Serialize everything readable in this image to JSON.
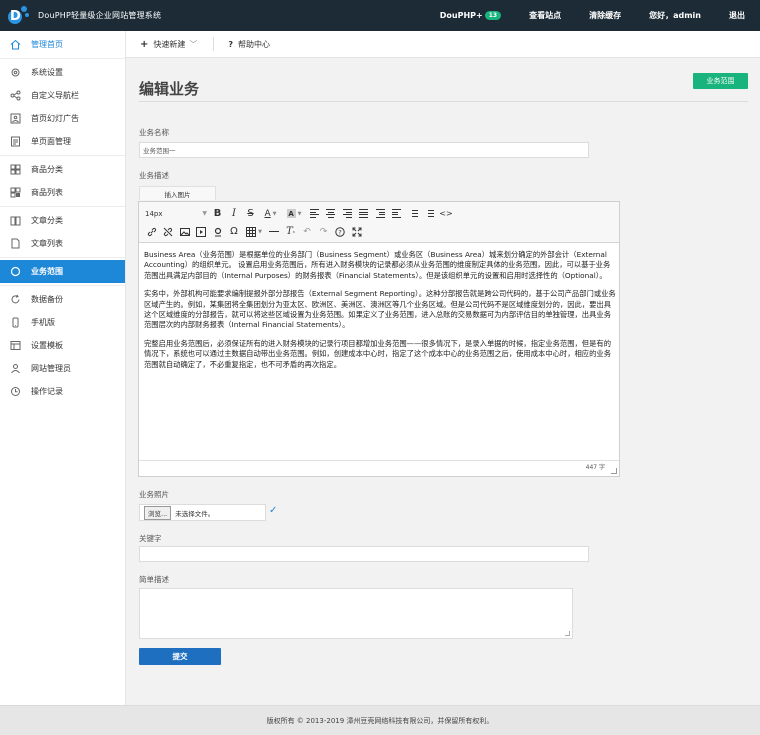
{
  "header": {
    "site_title": "DouPHP轻量级企业网站管理系统",
    "brand": "DouPHP+",
    "brand_badge": "13",
    "view_site": "查看站点",
    "clear_cache": "清除缓存",
    "greeting": "您好，admin",
    "logout": "退出"
  },
  "sidebar": {
    "home": "管理首页",
    "items": [
      {
        "label": "系统设置",
        "icon": "gear-icon"
      },
      {
        "label": "自定义导航栏",
        "icon": "share-icon"
      },
      {
        "label": "首页幻灯广告",
        "icon": "image-icon"
      },
      {
        "label": "单页面管理",
        "icon": "page-icon"
      },
      {
        "label": "商品分类",
        "icon": "grid-icon"
      },
      {
        "label": "商品列表",
        "icon": "grid-list-icon"
      },
      {
        "label": "文章分类",
        "icon": "book-icon"
      },
      {
        "label": "文章列表",
        "icon": "file-icon"
      },
      {
        "label": "业务范围",
        "icon": "circle-icon"
      },
      {
        "label": "数据备份",
        "icon": "refresh-icon"
      },
      {
        "label": "手机版",
        "icon": "phone-icon"
      },
      {
        "label": "设置模板",
        "icon": "template-icon"
      },
      {
        "label": "网站管理员",
        "icon": "user-icon"
      },
      {
        "label": "操作记录",
        "icon": "clock-icon"
      }
    ]
  },
  "subbar": {
    "quick_new": "快速新建",
    "help": "帮助中心"
  },
  "main": {
    "page_title": "编辑业务",
    "range_button": "业务范围",
    "name_label": "业务名称",
    "name_value": "业务范围一",
    "desc_label": "业务描述",
    "insert_image": "插入图片",
    "font_size": "14px",
    "paragraphs": [
      "Business Area（业务范围）是根据单位的业务部门（Business Segment）或业务区（Business Area）城来划分确定的外部会计（External Accounting）的组织单元。 设置启用业务范围后，所有进入财务模块的记录都必须从业务范围的维度制定具体的业务范围，因此，可以基于业务范围出具满足内部目的（Internal Purposes）的财务报表（Financial Statements）。但是该组织单元的设置和启用时选择性的（Optional）。",
      "实务中，外部机构可能要求编制提报外部分部报告（External Segment Reporting）。这种分部报告就是跨公司代码的，基于公司产品部门或业务区域产生的。例如，某集团将全集团划分为亚太区、欧洲区、美洲区、澳洲区等几个业务区域。但是公司代码不是区域维度划分的，因此，要出具这个区域维度的分部报告，就可以将这些区域设置为业务范围。如果定义了业务范围，进入总账的交易数据可为内部评估目的单独管理，出具业务范围层次的内部财务报表（Internal Financial Statements）。",
      "完整启用业务范围后，必须保证所有的进入财务模块的记录行项目都增加业务范围——很多情况下，是录入单据的时候，指定业务范围，但是有的情况下，系统也可以通过主数据自动带出业务范围。例如，创建成本中心时，指定了这个成本中心的业务范围之后，使用成本中心时，相应的业务范围就自动确定了，不必重复指定，也不可矛盾的再次指定。"
    ],
    "word_count": "447 字",
    "photo_label": "业务照片",
    "browse_button": "浏览...",
    "no_file": "未选择文件。",
    "keyword_label": "关键字",
    "keyword_value": "",
    "summary_label": "简单描述",
    "submit_label": "提交"
  },
  "footer": {
    "copyright": "版权所有 © 2013-2019 漳州豆壳网络科技有限公司，并保留所有权利。"
  },
  "colors": {
    "topbar": "#1c2b36",
    "accent_blue": "#1e88d8",
    "accent_green": "#19b37d",
    "submit_blue": "#1e6fc0"
  }
}
